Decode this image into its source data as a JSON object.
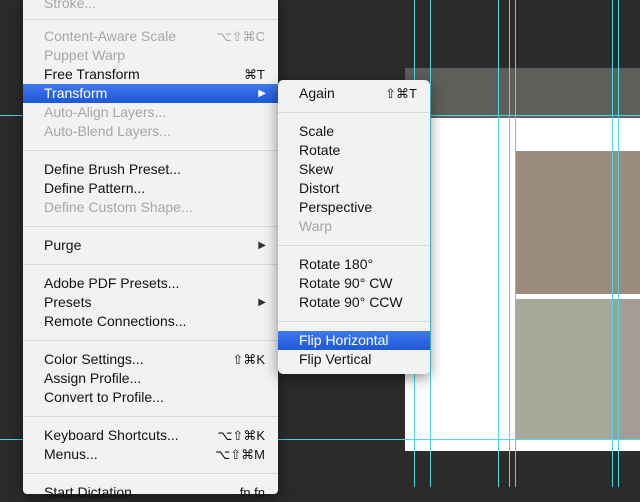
{
  "edit_menu": {
    "items": [
      {
        "label": "Stroke...",
        "enabled": false
      },
      {
        "separator": true
      },
      {
        "label": "Content-Aware Scale",
        "shortcut": "⌥⇧⌘C",
        "enabled": false
      },
      {
        "label": "Puppet Warp",
        "enabled": false
      },
      {
        "label": "Free Transform",
        "shortcut": "⌘T",
        "enabled": true
      },
      {
        "label": "Transform",
        "submenu": true,
        "highlighted": true,
        "enabled": true
      },
      {
        "label": "Auto-Align Layers...",
        "enabled": false
      },
      {
        "label": "Auto-Blend Layers...",
        "enabled": false
      },
      {
        "separator": true
      },
      {
        "label": "Define Brush Preset...",
        "enabled": true
      },
      {
        "label": "Define Pattern...",
        "enabled": true
      },
      {
        "label": "Define Custom Shape...",
        "enabled": false
      },
      {
        "separator": true
      },
      {
        "label": "Purge",
        "submenu": true,
        "enabled": true
      },
      {
        "separator": true
      },
      {
        "label": "Adobe PDF Presets...",
        "enabled": true
      },
      {
        "label": "Presets",
        "submenu": true,
        "enabled": true
      },
      {
        "label": "Remote Connections...",
        "enabled": true
      },
      {
        "separator": true
      },
      {
        "label": "Color Settings...",
        "shortcut": "⇧⌘K",
        "enabled": true
      },
      {
        "label": "Assign Profile...",
        "enabled": true
      },
      {
        "label": "Convert to Profile...",
        "enabled": true
      },
      {
        "separator": true
      },
      {
        "label": "Keyboard Shortcuts...",
        "shortcut": "⌥⇧⌘K",
        "enabled": true
      },
      {
        "label": "Menus...",
        "shortcut": "⌥⇧⌘M",
        "enabled": true
      },
      {
        "separator": true
      },
      {
        "label": "Start Dictation",
        "shortcut": "fn fn",
        "enabled": true
      }
    ]
  },
  "transform_submenu": {
    "items": [
      {
        "label": "Again",
        "shortcut": "⇧⌘T",
        "enabled": true
      },
      {
        "separator": true
      },
      {
        "label": "Scale",
        "enabled": true
      },
      {
        "label": "Rotate",
        "enabled": true
      },
      {
        "label": "Skew",
        "enabled": true
      },
      {
        "label": "Distort",
        "enabled": true
      },
      {
        "label": "Perspective",
        "enabled": true
      },
      {
        "label": "Warp",
        "enabled": false
      },
      {
        "separator": true
      },
      {
        "label": "Rotate 180°",
        "enabled": true
      },
      {
        "label": "Rotate 90° CW",
        "enabled": true
      },
      {
        "label": "Rotate 90° CCW",
        "enabled": true
      },
      {
        "separator": true
      },
      {
        "label": "Flip Horizontal",
        "enabled": true,
        "highlighted": true
      },
      {
        "label": "Flip Vertical",
        "enabled": true
      }
    ]
  },
  "submenu_arrow": "▶",
  "colors": {
    "highlight": "#2b62e0",
    "guide": "#4fd7e6",
    "menu_bg": "#f2f2f2",
    "canvas_bg": "#2b2b2b"
  }
}
